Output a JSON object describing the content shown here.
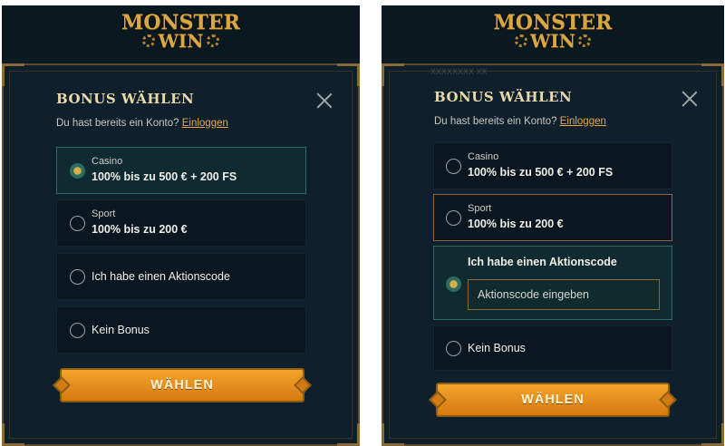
{
  "logo": {
    "line1": "MONSTER",
    "line2": "WIN"
  },
  "modal": {
    "title": "BONUS WÄHLEN",
    "login_text": "Du hast bereits ein Konto?",
    "login_link": "Einloggen",
    "choose_button": "WÄHLEN"
  },
  "left_screen": {
    "options": [
      {
        "sub": "Casino",
        "main": "100% bis zu 500 € + 200 FS",
        "selected": true
      },
      {
        "sub": "Sport",
        "main": "100% bis zu 200 €",
        "selected": false
      },
      {
        "sub": "",
        "main": "Ich habe einen Aktionscode",
        "selected": false
      },
      {
        "sub": "",
        "main": "Kein Bonus",
        "selected": false
      }
    ]
  },
  "right_screen": {
    "faded_text": "XXXXXXXX XX",
    "options": [
      {
        "sub": "Casino",
        "main": "100% bis zu 500 € + 200 FS",
        "selected": false
      },
      {
        "sub": "Sport",
        "main": "100% bis zu 200 €",
        "selected": false
      },
      {
        "sub": "",
        "main": "Ich habe einen Aktionscode",
        "selected": true
      },
      {
        "sub": "",
        "main": "Kein Bonus",
        "selected": false
      }
    ],
    "promo_placeholder": "Aktionscode eingeben"
  },
  "colors": {
    "accent_orange": "#e99520",
    "gold": "#d9a845",
    "teal_selected": "#2c6b5e",
    "background": "#0c1a24"
  }
}
